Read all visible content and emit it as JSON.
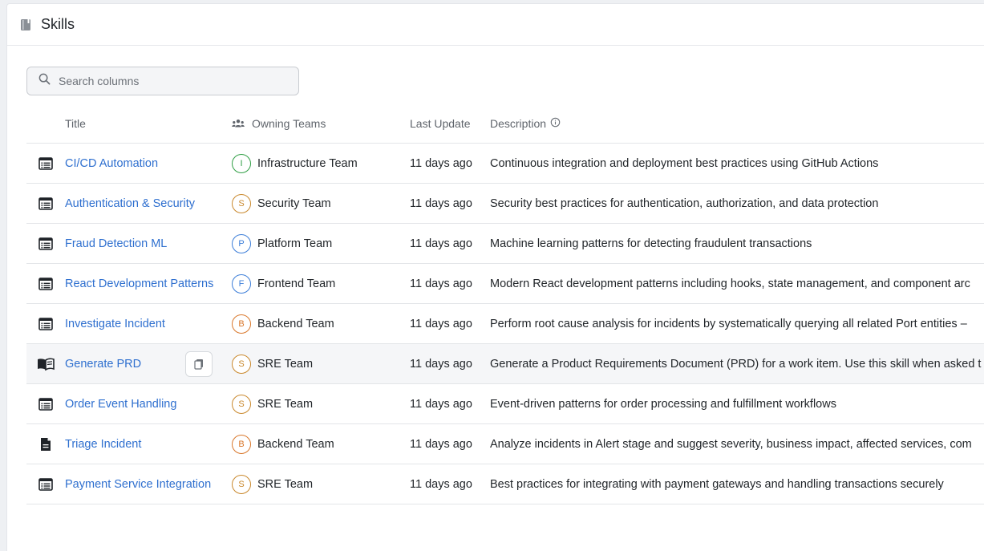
{
  "header": {
    "title": "Skills"
  },
  "search": {
    "placeholder": "Search columns"
  },
  "columns": {
    "title": "Title",
    "owning_teams": "Owning Teams",
    "last_update": "Last Update",
    "description": "Description"
  },
  "rows": [
    {
      "icon": "list-doc-icon",
      "title": "CI/CD Automation",
      "team_initial": "I",
      "team": "Infrastructure Team",
      "team_color": "#2f9e44",
      "updated": "11 days ago",
      "description": "Continuous integration and deployment best practices using GitHub Actions"
    },
    {
      "icon": "list-doc-icon",
      "title": "Authentication & Security",
      "team_initial": "S",
      "team": "Security Team",
      "team_color": "#c9882c",
      "updated": "11 days ago",
      "description": "Security best practices for authentication, authorization, and data protection"
    },
    {
      "icon": "list-doc-icon",
      "title": "Fraud Detection ML",
      "team_initial": "P",
      "team": "Platform Team",
      "team_color": "#3b7dd8",
      "updated": "11 days ago",
      "description": "Machine learning patterns for detecting fraudulent transactions"
    },
    {
      "icon": "list-doc-icon",
      "title": "React Development Patterns",
      "team_initial": "F",
      "team": "Frontend Team",
      "team_color": "#3b7dd8",
      "updated": "11 days ago",
      "description": "Modern React development patterns including hooks, state management, and component arc"
    },
    {
      "icon": "list-doc-icon",
      "title": "Investigate Incident",
      "team_initial": "B",
      "team": "Backend Team",
      "team_color": "#d9772b",
      "updated": "11 days ago",
      "description": "Perform root cause analysis for incidents by systematically querying all related Port entities –"
    },
    {
      "icon": "open-book-icon",
      "title": "Generate PRD",
      "team_initial": "S",
      "team": "SRE Team",
      "team_color": "#c9882c",
      "updated": "11 days ago",
      "description": "Generate a Product Requirements Document (PRD) for a work item. Use this skill when asked t",
      "highlight": true
    },
    {
      "icon": "list-doc-icon",
      "title": "Order Event Handling",
      "team_initial": "S",
      "team": "SRE Team",
      "team_color": "#c9882c",
      "updated": "11 days ago",
      "description": "Event-driven patterns for order processing and fulfillment workflows"
    },
    {
      "icon": "file-icon",
      "title": "Triage Incident",
      "team_initial": "B",
      "team": "Backend Team",
      "team_color": "#d9772b",
      "updated": "11 days ago",
      "description": "Analyze incidents in Alert stage and suggest severity, business impact, affected services, com"
    },
    {
      "icon": "list-doc-icon",
      "title": "Payment Service Integration",
      "team_initial": "S",
      "team": "SRE Team",
      "team_color": "#c9882c",
      "updated": "11 days ago",
      "description": "Best practices for integrating with payment gateways and handling transactions securely"
    }
  ]
}
